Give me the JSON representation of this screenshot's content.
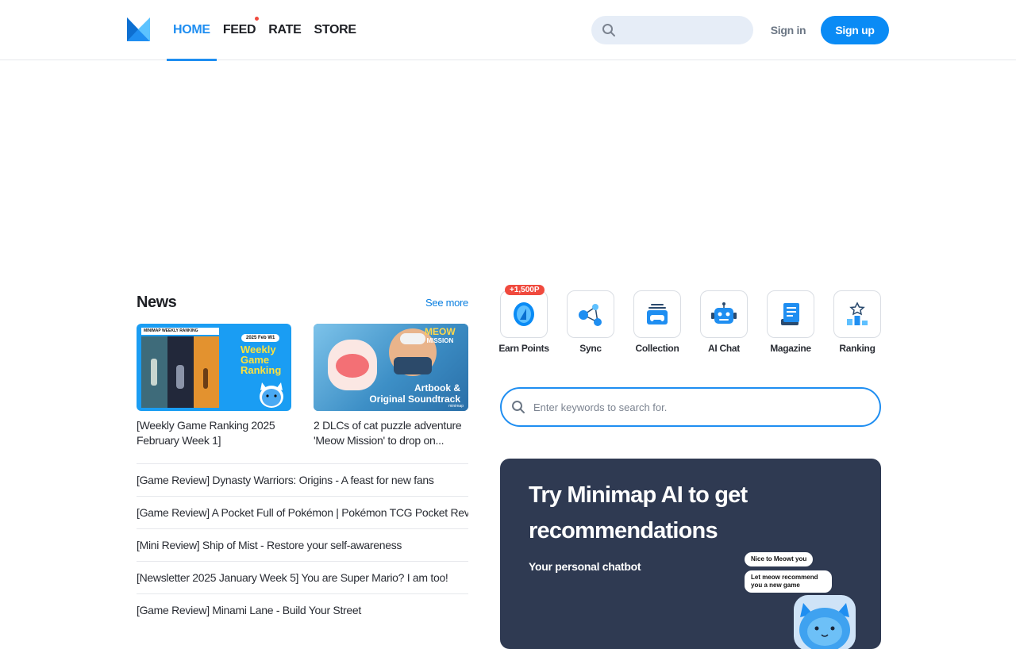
{
  "header": {
    "logo": "minimap-logo",
    "nav": [
      {
        "label": "HOME",
        "active": true
      },
      {
        "label": "FEED",
        "has_dot": true
      },
      {
        "label": "RATE"
      },
      {
        "label": "STORE"
      }
    ],
    "search_placeholder": "",
    "signin_label": "Sign in",
    "signup_label": "Sign up"
  },
  "news": {
    "title": "News",
    "see_more": "See more",
    "cards": [
      {
        "title": "[Weekly Game Ranking 2025 February Week 1]",
        "thumb_header": "MINIMAP WEEKLY RANKING",
        "thumb_badge": "2025 Feb W1",
        "thumb_text": [
          "Weekly",
          "Game",
          "Ranking"
        ]
      },
      {
        "title": "2 DLCs of cat puzzle adventure 'Meow Mission' to drop on...",
        "thumb_logo": [
          "MEOW",
          "MISSION"
        ],
        "thumb_text": [
          "Artbook &",
          "Original Soundtrack"
        ],
        "thumb_brand": "minimap"
      }
    ],
    "items": [
      "[Game Review] Dynasty Warriors: Origins - A feast for new fans",
      "[Game Review] A Pocket Full of Pokémon | Pokémon TCG Pocket Review",
      "[Mini Review] Ship of Mist - Restore your self-awareness",
      "[Newsletter 2025 January Week 5] You are Super Mario? I am too!",
      "[Game Review] Minami Lane - Build Your Street"
    ]
  },
  "quick_links": [
    {
      "label": "Earn Points",
      "icon": "coin-icon",
      "badge": "+1,500P"
    },
    {
      "label": "Sync",
      "icon": "sync-nodes-icon"
    },
    {
      "label": "Collection",
      "icon": "collection-icon"
    },
    {
      "label": "AI Chat",
      "icon": "robot-icon"
    },
    {
      "label": "Magazine",
      "icon": "magazine-icon"
    },
    {
      "label": "Ranking",
      "icon": "ranking-podium-icon"
    }
  ],
  "main_search": {
    "placeholder": "Enter keywords to search for."
  },
  "promo": {
    "title": "Try Minimap AI to get recommendations",
    "subtitle": "Your personal chatbot",
    "bubbles": [
      "Nice to Meowt you",
      "Let meow recommend you a new game"
    ]
  },
  "colors": {
    "accent": "#1f8ef1",
    "signup_bg": "#0a8bf5",
    "badge_red": "#f04a3e",
    "promo_bg": "#2f3a52",
    "search_bg": "#e6edf7"
  }
}
